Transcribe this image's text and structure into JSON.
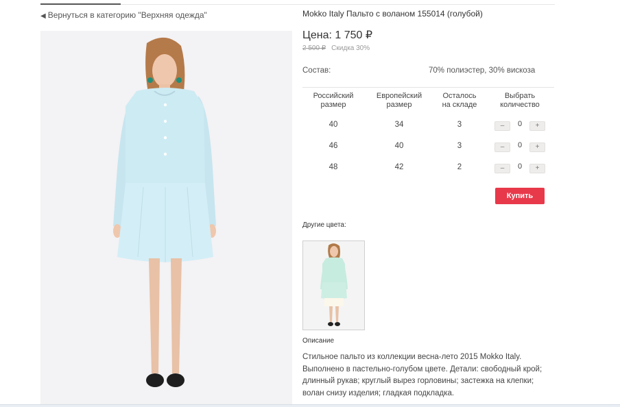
{
  "nav": {
    "back_label": "Вернуться в категорию \"Верхняя одежда\""
  },
  "product": {
    "title": "Mokko Italy Пальто с воланом 155014 (голубой)",
    "price_label": "Цена:",
    "price": "1 750 ₽",
    "old_price": "2 500 ₽",
    "discount": "Скидка 30%",
    "composition_label": "Состав:",
    "composition": "70% полиэстер, 30% вискоза",
    "main_photo_icon": "woman-in-light-blue-coat-photo"
  },
  "sizes_table": {
    "headers": [
      [
        "Российский",
        "размер"
      ],
      [
        "Европейский",
        "размер"
      ],
      [
        "Осталось",
        "на складе"
      ],
      [
        "Выбрать",
        "количество"
      ]
    ],
    "rows": [
      {
        "ru": "40",
        "eu": "34",
        "stock": "3",
        "qty": "0"
      },
      {
        "ru": "46",
        "eu": "40",
        "stock": "3",
        "qty": "0"
      },
      {
        "ru": "48",
        "eu": "42",
        "stock": "2",
        "qty": "0"
      }
    ],
    "minus_label": "–",
    "plus_label": "+"
  },
  "buy_label": "Купить",
  "other_colors": {
    "label": "Другие цвета:",
    "thumb_icon": "mint-coat-variant-thumbnail"
  },
  "description": {
    "heading": "Описание",
    "lines": [
      "Стильное пальто из коллекции весна-лето 2015 Mokko Italy.",
      "Выполнено в пастельно-голубом цвете. Детали: свободный крой;",
      "длинный рукав; круглый вырез горловины; застежка на клепки;",
      "волан снизу изделия; гладкая подкладка."
    ]
  },
  "colors": {
    "accent": "#e8394a",
    "coat": "#c9e8f1",
    "thumb_coat": "#c6ecdf"
  }
}
